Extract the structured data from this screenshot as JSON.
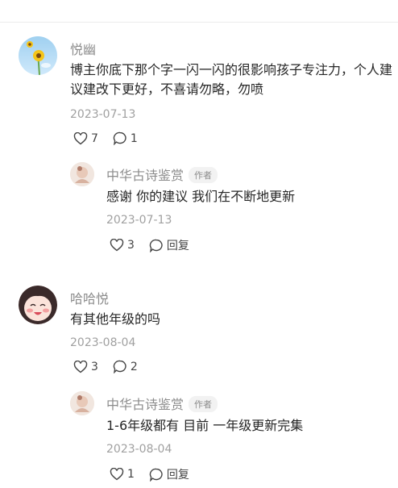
{
  "comments": [
    {
      "user": "悦幽",
      "lines": [
        "博主你底下那个字一闪一闪的很影响孩子专注力，个人建",
        "议建改下更好，不喜请勿略，勿喷"
      ],
      "date": "2023-07-13",
      "likes": "7",
      "replies_count": "1",
      "reply": {
        "user": "中华古诗鉴赏",
        "badge": "作者",
        "text": "感谢 你的建议 我们在不断地更新",
        "date": "2023-07-13",
        "likes": "3",
        "reply_label": "回复"
      }
    },
    {
      "user": "哈哈悦",
      "lines": [
        "有其他年级的吗"
      ],
      "date": "2023-08-04",
      "likes": "3",
      "replies_count": "2",
      "reply": {
        "user": "中华古诗鉴赏",
        "badge": "作者",
        "text": "1-6年级都有 目前 一年级更新完集",
        "date": "2023-08-04",
        "likes": "1",
        "reply_label": "回复"
      }
    }
  ],
  "colors": {
    "name": "#8c8c8c",
    "date": "#a0a0a0",
    "text": "#262626"
  }
}
